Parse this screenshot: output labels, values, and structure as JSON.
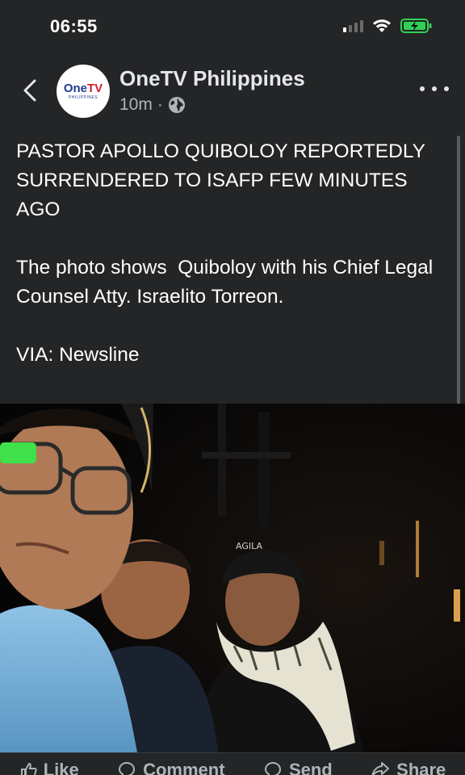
{
  "status_bar": {
    "time": "06:55",
    "icons": [
      "cellular-signal-icon",
      "wifi-icon",
      "battery-charging-icon"
    ],
    "battery_color": "#31d158"
  },
  "header": {
    "back_icon": "chevron-left-icon",
    "avatar": {
      "logo_one": "One",
      "logo_tv": "TV",
      "logo_sub": "PHILIPPINES"
    },
    "page_name": "OneTV Philippines",
    "time_ago": "10m",
    "separator": "·",
    "audience_icon": "globe-icon",
    "more_icon": "more-dots-icon"
  },
  "post": {
    "headline": "PASTOR APOLLO QUIBOLOY REPORTEDLY SURRENDERED TO ISAFP FEW MINUTES AGO",
    "body": "The photo shows  Quiboloy with his Chief Legal Counsel Atty. Israelito Torreon.",
    "source": "VIA: Newsline"
  },
  "photo": {
    "cap_text": "AGILA"
  },
  "actions": [
    {
      "label": "Like",
      "icon": "thumbs-up-icon"
    },
    {
      "label": "Comment",
      "icon": "comment-icon"
    },
    {
      "label": "Send",
      "icon": "send-icon"
    },
    {
      "label": "Share",
      "icon": "share-icon"
    }
  ]
}
